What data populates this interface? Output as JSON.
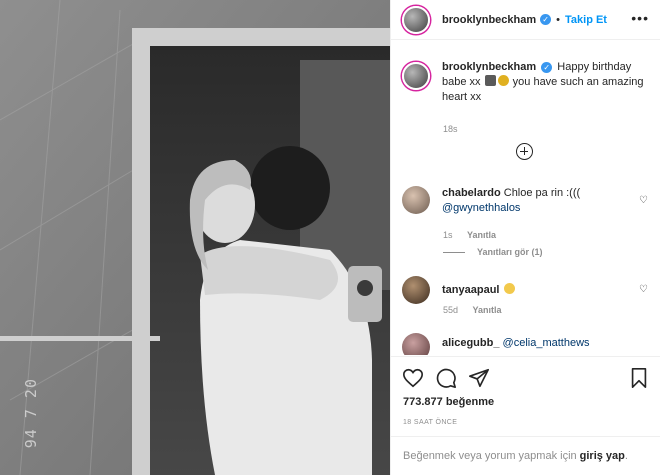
{
  "photo": {
    "alt_subject": "black and white mirror selfie",
    "date_stamp": "94 7 20"
  },
  "header": {
    "username": "brooklynbeckham",
    "verified_icon": "verified-badge-icon",
    "separator": "•",
    "follow_label": "Takip Et",
    "more_icon": "more-options-icon"
  },
  "caption": {
    "username": "brooklynbeckham",
    "text_before": "Happy birthday babe xx",
    "text_after": "you have such an amazing heart xx",
    "emojis": [
      "cake-icon",
      "kiss-face-icon"
    ],
    "time": "18s"
  },
  "load_more_icon": "plus-circle-icon",
  "comments": [
    {
      "username": "chabelardo",
      "text": "Chloe pa rin :(((",
      "mention": "@gwynethhalos",
      "time": "1s",
      "reply_label": "Yanıtla",
      "view_replies_label": "Yanıtları gör (1)"
    },
    {
      "username": "tanyaapaul",
      "text": "",
      "emoji": "heart-eyes-icon",
      "time": "55d",
      "reply_label": "Yanıtla"
    },
    {
      "username": "alicegubb_",
      "mention": "@celia_matthews"
    }
  ],
  "actions": {
    "like_icon": "heart-icon",
    "comment_icon": "comment-icon",
    "share_icon": "share-icon",
    "save_icon": "bookmark-icon",
    "likes_count": "773.877",
    "likes_label": "beğenme",
    "post_age": "18 SAAT ÖNCE"
  },
  "footer": {
    "prompt": "Beğenmek veya yorum yapmak için",
    "login_link": "giriş yap",
    "period": "."
  },
  "colors": {
    "link_blue": "#0095f6",
    "mention_blue": "#00376b",
    "verified_blue": "#3897f0",
    "muted_text": "#8e8e8e",
    "border": "#efefef"
  }
}
